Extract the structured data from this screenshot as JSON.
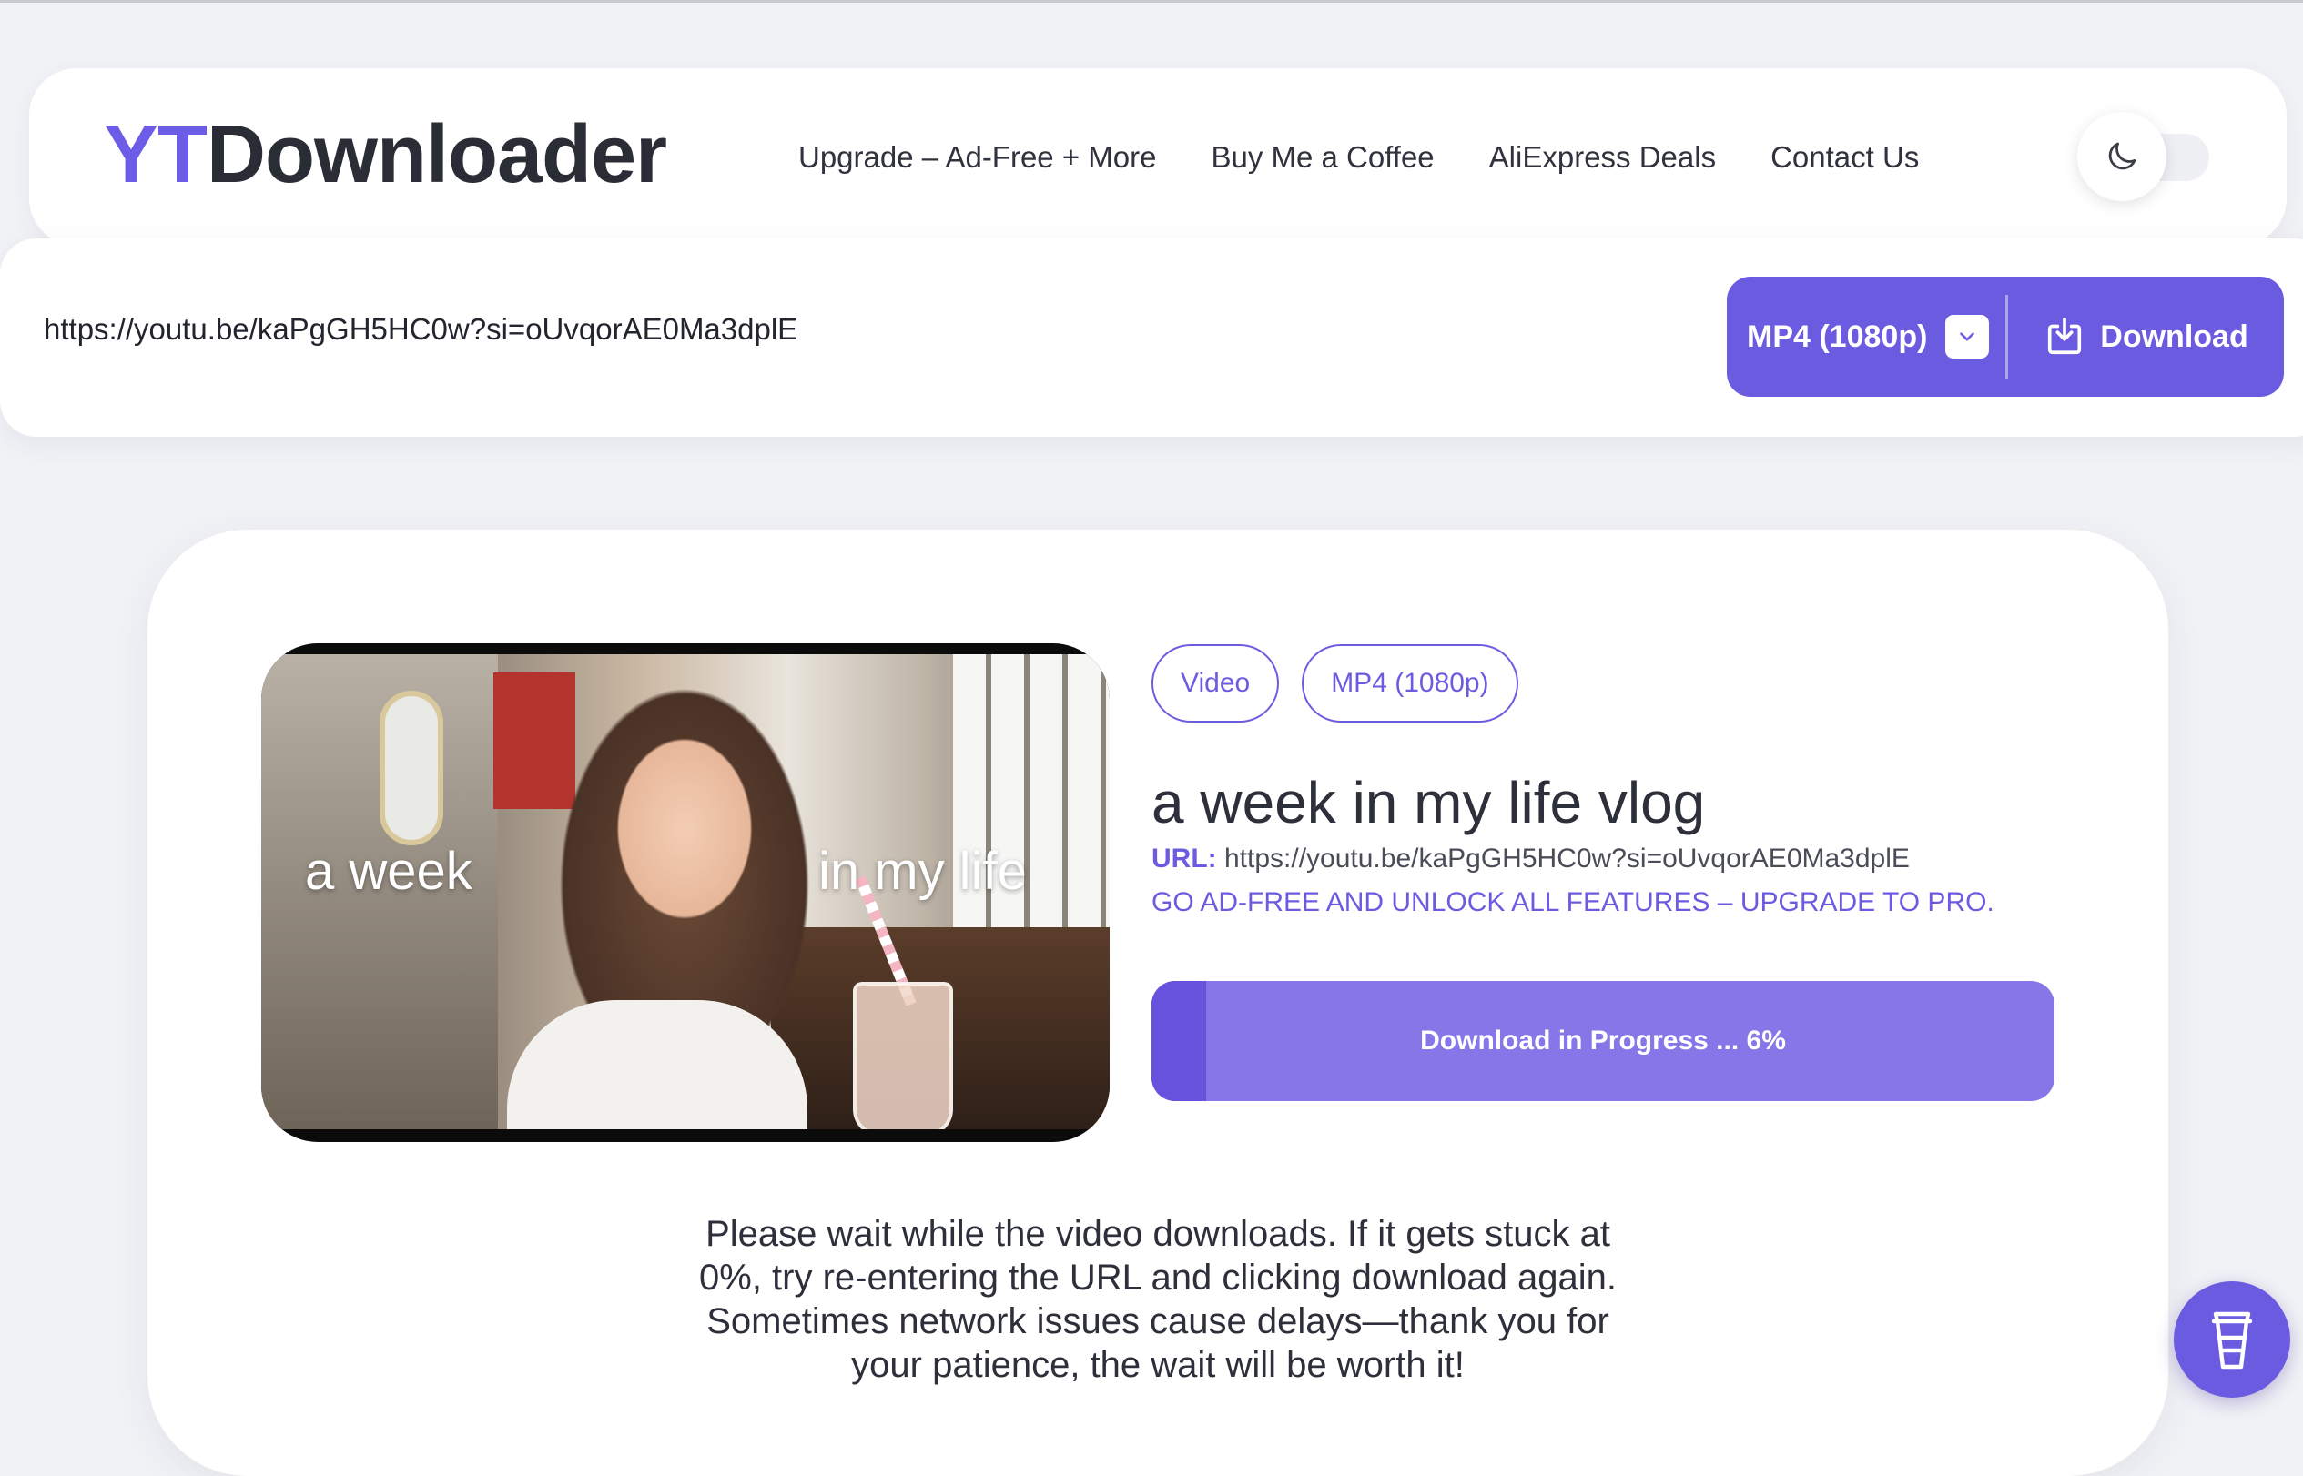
{
  "header": {
    "logo_yt": "YT",
    "logo_rest": "Downloader",
    "nav": [
      {
        "label": "Upgrade – Ad-Free + More"
      },
      {
        "label": "Buy Me a Coffee"
      },
      {
        "label": "AliExpress Deals"
      },
      {
        "label": "Contact Us"
      }
    ],
    "theme_toggle_icon": "moon-icon",
    "dark_mode_enabled": false
  },
  "url_bar": {
    "value": "https://youtu.be/kaPgGH5HC0w?si=oUvqorAE0Ma3dplE",
    "format_selected": "MP4 (1080p)",
    "download_label": "Download"
  },
  "result": {
    "thumbnail_text_left": "a week",
    "thumbnail_text_right": "in my life",
    "tags": [
      "Video",
      "MP4 (1080p)"
    ],
    "title": "a week in my life vlog",
    "url_label": "URL:",
    "url_value": "https://youtu.be/kaPgGH5HC0w?si=oUvqorAE0Ma3dplE",
    "promo": "GO AD-FREE AND UNLOCK ALL FEATURES – UPGRADE TO PRO.",
    "progress_label": "Download in Progress ... 6%",
    "progress_percent": 6,
    "wait_message": "Please wait while the video downloads. If it gets stuck at 0%, try re-entering the URL and clicking download again. Sometimes network issues cause delays—thank you for your patience, the wait will be worth it!"
  },
  "colors": {
    "accent": "#6b5be1",
    "progress_track": "#8677e8",
    "progress_fill": "#6652dc",
    "background": "#f1f2f6"
  },
  "fab": {
    "icon": "coffee-cup-icon"
  }
}
